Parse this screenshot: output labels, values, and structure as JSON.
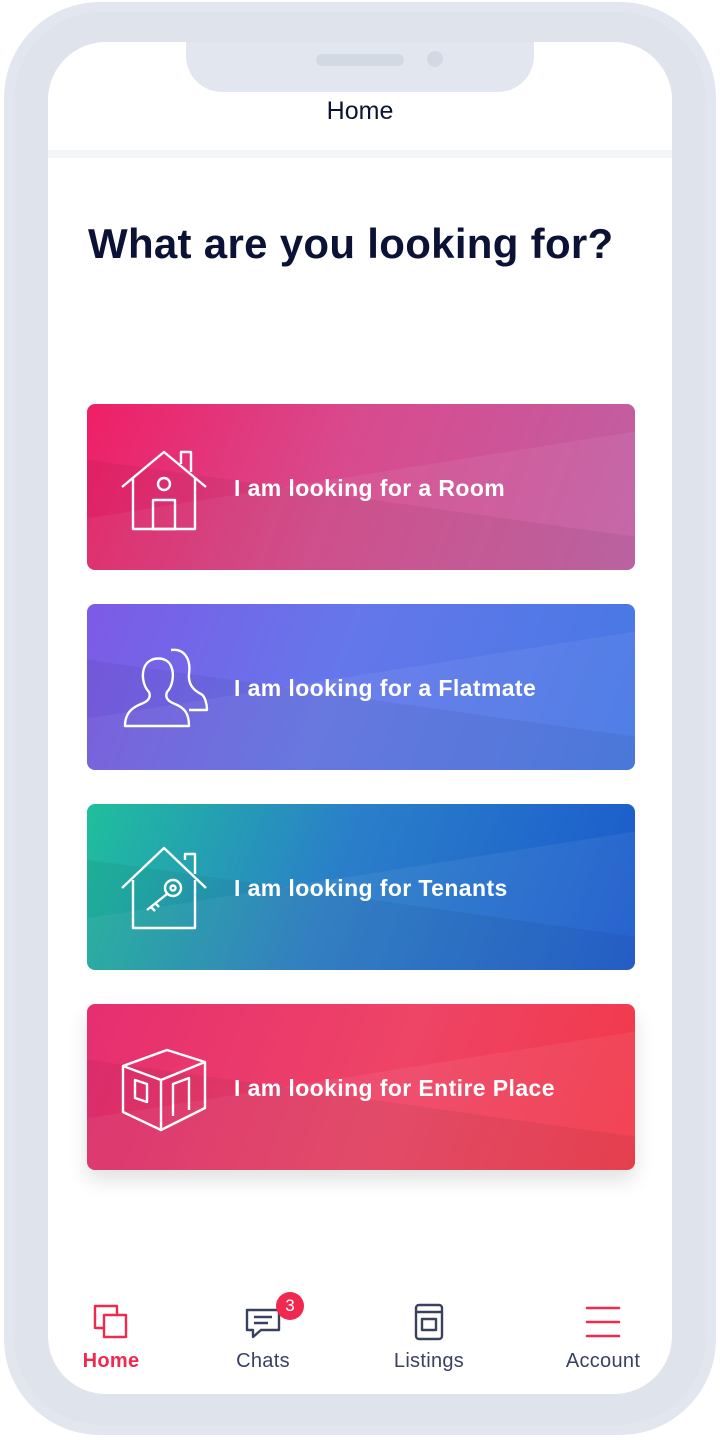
{
  "header": {
    "title": "Home"
  },
  "main": {
    "heading": "What are you looking for?",
    "options": [
      {
        "label": "I am looking for a Room",
        "icon": "house-icon"
      },
      {
        "label": "I am looking for a Flatmate",
        "icon": "people-icon"
      },
      {
        "label": "I am looking for Tenants",
        "icon": "house-key-icon"
      },
      {
        "label": "I am looking for Entire Place",
        "icon": "room-3d-icon"
      }
    ]
  },
  "tabbar": {
    "active": "Home",
    "items": [
      {
        "label": "Home",
        "icon": "home-squares-icon",
        "color": "#ef2a4e"
      },
      {
        "label": "Chats",
        "icon": "chat-bubble-icon",
        "badge": "3"
      },
      {
        "label": "Listings",
        "icon": "listings-icon"
      },
      {
        "label": "Account",
        "icon": "hamburger-menu-icon"
      }
    ]
  },
  "colors": {
    "accent": "#ef2a4e",
    "heading": "#0c1235",
    "frame": "#e2e7ef"
  }
}
